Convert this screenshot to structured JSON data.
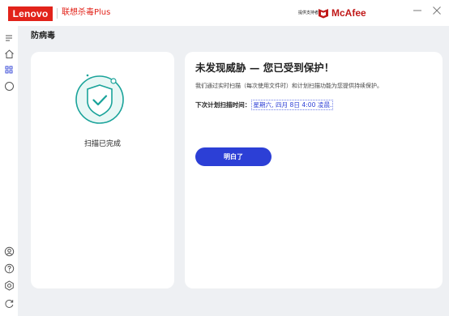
{
  "header": {
    "brand_badge": "Lenovo",
    "product_name": "联想杀毒Plus",
    "provided_by": "提供支持者",
    "mcafee_logo_text": "McAfee",
    "window_controls": [
      "minimize-icon",
      "close-icon"
    ]
  },
  "sidebar": {
    "items": [
      {
        "icon": "menu-icon"
      },
      {
        "icon": "home-icon"
      },
      {
        "icon": "apps-grid-icon"
      },
      {
        "icon": "circle-icon"
      },
      {
        "icon": "account-icon"
      },
      {
        "icon": "help-icon"
      },
      {
        "icon": "settings-icon"
      },
      {
        "icon": "refresh-icon"
      }
    ]
  },
  "main": {
    "page_title": "防病毒",
    "status_card": {
      "icon": "shield-check-icon",
      "status_text": "扫描已完成"
    },
    "result_card": {
      "headline": "未发现威胁 — 您已受到保护！",
      "description": "我们通过实时扫描（每次使用文件时）和计划扫描功能为您提供持续保护。",
      "next_scan_label": "下次计划扫描时间：",
      "next_scan_value": "星期六, 四月 8日 4:00 凌晨.",
      "button_label": "明白了"
    }
  },
  "colors": {
    "lenovo_red": "#e2231a",
    "mcafee_red": "#c01818",
    "accent_blue": "#2c3fd6",
    "shield_teal": "#1aa39a",
    "background": "#eef0f3"
  }
}
